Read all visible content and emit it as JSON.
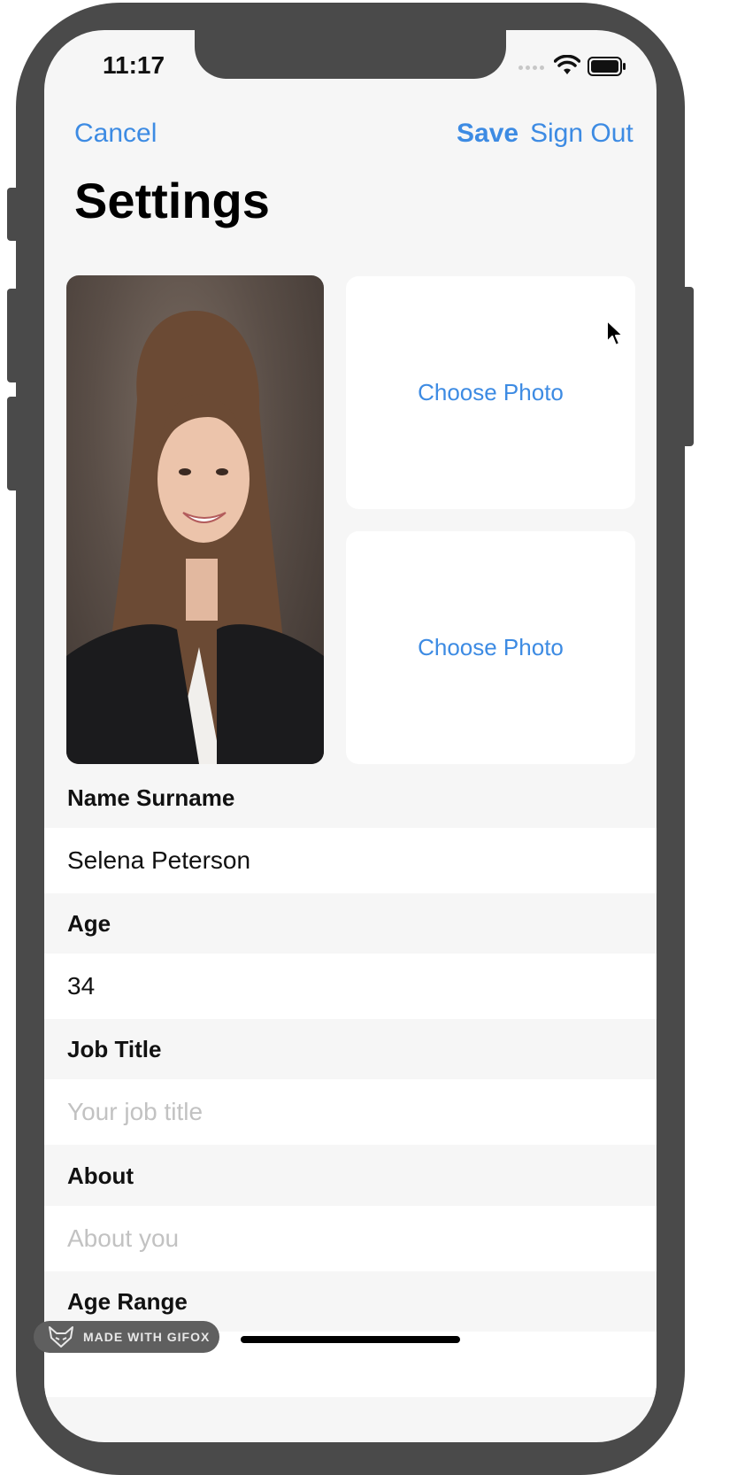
{
  "status_bar": {
    "time": "11:17"
  },
  "nav": {
    "cancel_label": "Cancel",
    "save_label": "Save",
    "sign_out_label": "Sign Out"
  },
  "page": {
    "title": "Settings"
  },
  "photos": {
    "slot_1_label": "Choose Photo",
    "slot_2_label": "Choose Photo"
  },
  "form": {
    "name": {
      "header": "Name Surname",
      "value": "Selena Peterson"
    },
    "age": {
      "header": "Age",
      "value": "34"
    },
    "job_title": {
      "header": "Job Title",
      "placeholder": "Your job title"
    },
    "about": {
      "header": "About",
      "placeholder": "About you"
    },
    "age_range": {
      "header": "Age Range"
    }
  },
  "watermark": {
    "text": "MADE WITH GIFOX"
  },
  "colors": {
    "accent": "#3d8be3",
    "frame": "#4a4a4a",
    "background": "#f6f6f6",
    "placeholder": "#c2c2c2"
  }
}
